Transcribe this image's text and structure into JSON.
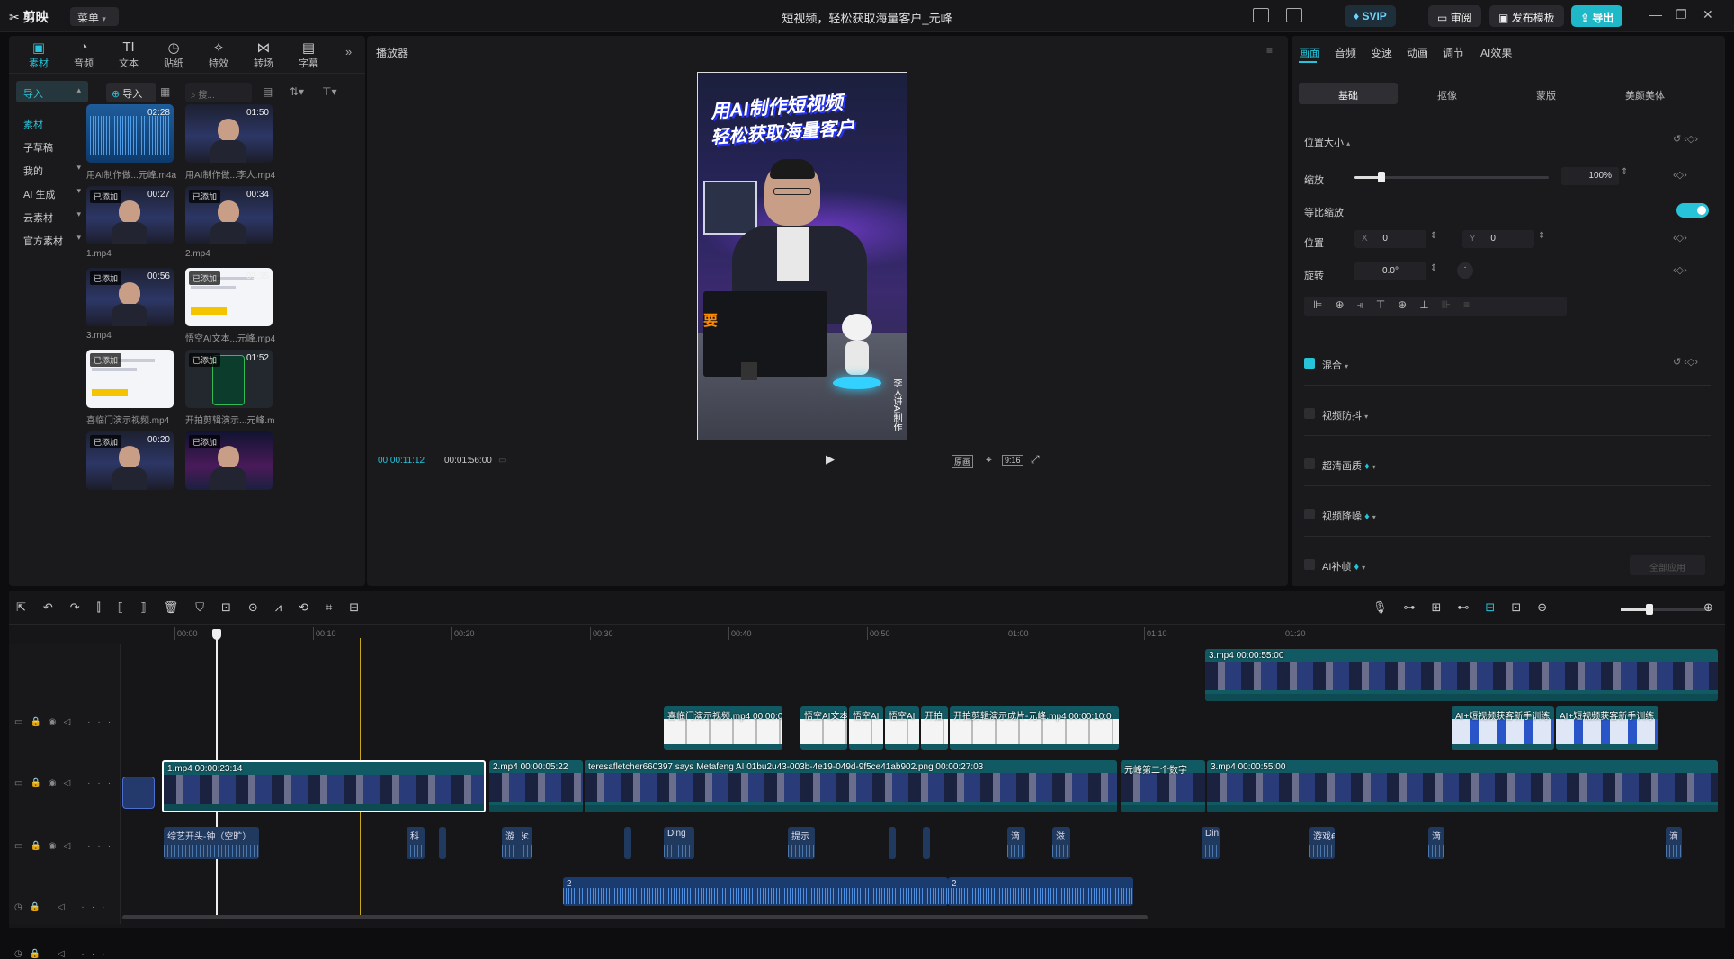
{
  "app": {
    "logo": "剪映",
    "menu_label": "菜单",
    "title": "短视频，轻松获取海量客户_元峰",
    "svip": "SVIP",
    "review": "审阅",
    "publish_template": "发布模板",
    "export": "导出"
  },
  "left_tools": [
    {
      "label": "素材",
      "glyph": "▣",
      "active": true
    },
    {
      "label": "音频",
      "glyph": "◔"
    },
    {
      "label": "文本",
      "glyph": "TI"
    },
    {
      "label": "贴纸",
      "glyph": "◷"
    },
    {
      "label": "特效",
      "glyph": "✧"
    },
    {
      "label": "转场",
      "glyph": "⋈"
    },
    {
      "label": "字幕",
      "glyph": "▤"
    }
  ],
  "left_sidebar": {
    "import_label": "导入",
    "items": [
      {
        "label": "素材",
        "selected": true
      },
      {
        "label": "子草稿"
      },
      {
        "label": "我的",
        "chev": true
      },
      {
        "label": "AI 生成",
        "chev": true
      },
      {
        "label": "云素材",
        "chev": true
      },
      {
        "label": "官方素材",
        "chev": true
      }
    ]
  },
  "media": {
    "import_button": "导入",
    "search_placeholder": "搜...",
    "all_label": "全部",
    "added_tag": "已添加",
    "items": [
      {
        "name": "用AI制作做...元峰.m4a",
        "dur": "02:28",
        "added": false,
        "kind": "audio"
      },
      {
        "name": "用AI制作做...李人.mp4",
        "dur": "01:50",
        "added": false,
        "kind": "video"
      },
      {
        "name": "1.mp4",
        "dur": "00:27",
        "added": true,
        "kind": "video"
      },
      {
        "name": "2.mp4",
        "dur": "00:34",
        "added": true,
        "kind": "video"
      },
      {
        "name": "3.mp4",
        "dur": "00:56",
        "added": true,
        "kind": "video"
      },
      {
        "name": "悟空AI文本...元峰.mp4",
        "dur": "01:35",
        "added": true,
        "kind": "screen"
      },
      {
        "name": "喜临门演示视频.mp4",
        "dur": "",
        "added": true,
        "kind": "screen"
      },
      {
        "name": "开拍剪辑演示...元峰.mp4",
        "dur": "01:52",
        "added": true,
        "kind": "phone"
      },
      {
        "name": "",
        "dur": "00:20",
        "added": true,
        "kind": "video"
      },
      {
        "name": "",
        "dur": "",
        "added": true,
        "kind": "neon"
      }
    ]
  },
  "player": {
    "title": "播放器",
    "headline_1": "用AI制作短视频",
    "headline_2": "轻松获取海量客户",
    "side_char": "要",
    "side_caption": "李人讲AI制作",
    "current_time": "00:00:11:12",
    "total_time": "00:01:56:00",
    "ratio_label": "9:16",
    "original_label": "原画"
  },
  "right_panel": {
    "tabs": [
      "画面",
      "音频",
      "变速",
      "动画",
      "调节",
      "AI效果"
    ],
    "sub_tabs": [
      "基础",
      "抠像",
      "蒙版",
      "美颜美体"
    ],
    "section_pos_size": "位置大小",
    "scale_label": "缩放",
    "scale_value": "100%",
    "scale_fraction": 0.14,
    "uniform_scale_label": "等比缩放",
    "position_label": "位置",
    "x_label": "X",
    "x_value": "0",
    "y_label": "Y",
    "y_value": "0",
    "rotate_label": "旋转",
    "rotate_value": "0.0°",
    "blend_label": "混合",
    "stabilize_label": "视频防抖",
    "hd_label": "超清画质",
    "denoise_label": "视频降噪",
    "ai_frame_label": "AI补帧",
    "apply_all": "全部应用"
  },
  "timeline": {
    "ruler": [
      "00:00",
      "00:10",
      "00:20",
      "00:30",
      "00:40",
      "00:50",
      "01:00",
      "01:10",
      "01:20"
    ],
    "clips_top": [
      {
        "label": "3.mp4  00:00:55:00"
      }
    ],
    "clips_overlay": [
      {
        "label": "喜临门演示视频.mp4  00:00:08:16"
      },
      {
        "label": "悟空AI文本"
      },
      {
        "label": "悟空AI"
      },
      {
        "label": "悟空AI"
      },
      {
        "label": "开拍"
      },
      {
        "label": "开拍剪辑演示成片-元峰.mp4  00:00:10:0"
      },
      {
        "label": "AI+短视频获客新手训练"
      },
      {
        "label": "AI+短视频获客新手训练"
      }
    ],
    "clips_main": [
      {
        "label": "1.mp4  00:00:23:14"
      },
      {
        "label": "2.mp4  00:00:05:22"
      },
      {
        "label": "teresafletcher660397 says Metafeng AI 01bu2u43-003b-4e19-049d-9f5ce41ab902.png  00:00:27:03"
      },
      {
        "label": "元峰第二个数字"
      },
      {
        "label": "3.mp4  00:00:55:00"
      }
    ],
    "audio_sfx": [
      {
        "label": "综艺开头-钟（空旷）"
      },
      {
        "label": "科"
      },
      {
        "label": "游戏€"
      },
      {
        "label": "Ding"
      },
      {
        "label": "提示"
      },
      {
        "label": "滴"
      },
      {
        "label": "滋"
      },
      {
        "label": "Din"
      },
      {
        "label": "游戏€"
      },
      {
        "label": "滴"
      },
      {
        "label": "滴"
      }
    ],
    "audio_voice": [
      {
        "label": "2"
      },
      {
        "label": "2"
      }
    ]
  },
  "colors": {
    "accent": "#27c3d8",
    "video_clip": "#125a63",
    "audio_clip": "#1f3a5e",
    "playhead": "#ffffff"
  }
}
